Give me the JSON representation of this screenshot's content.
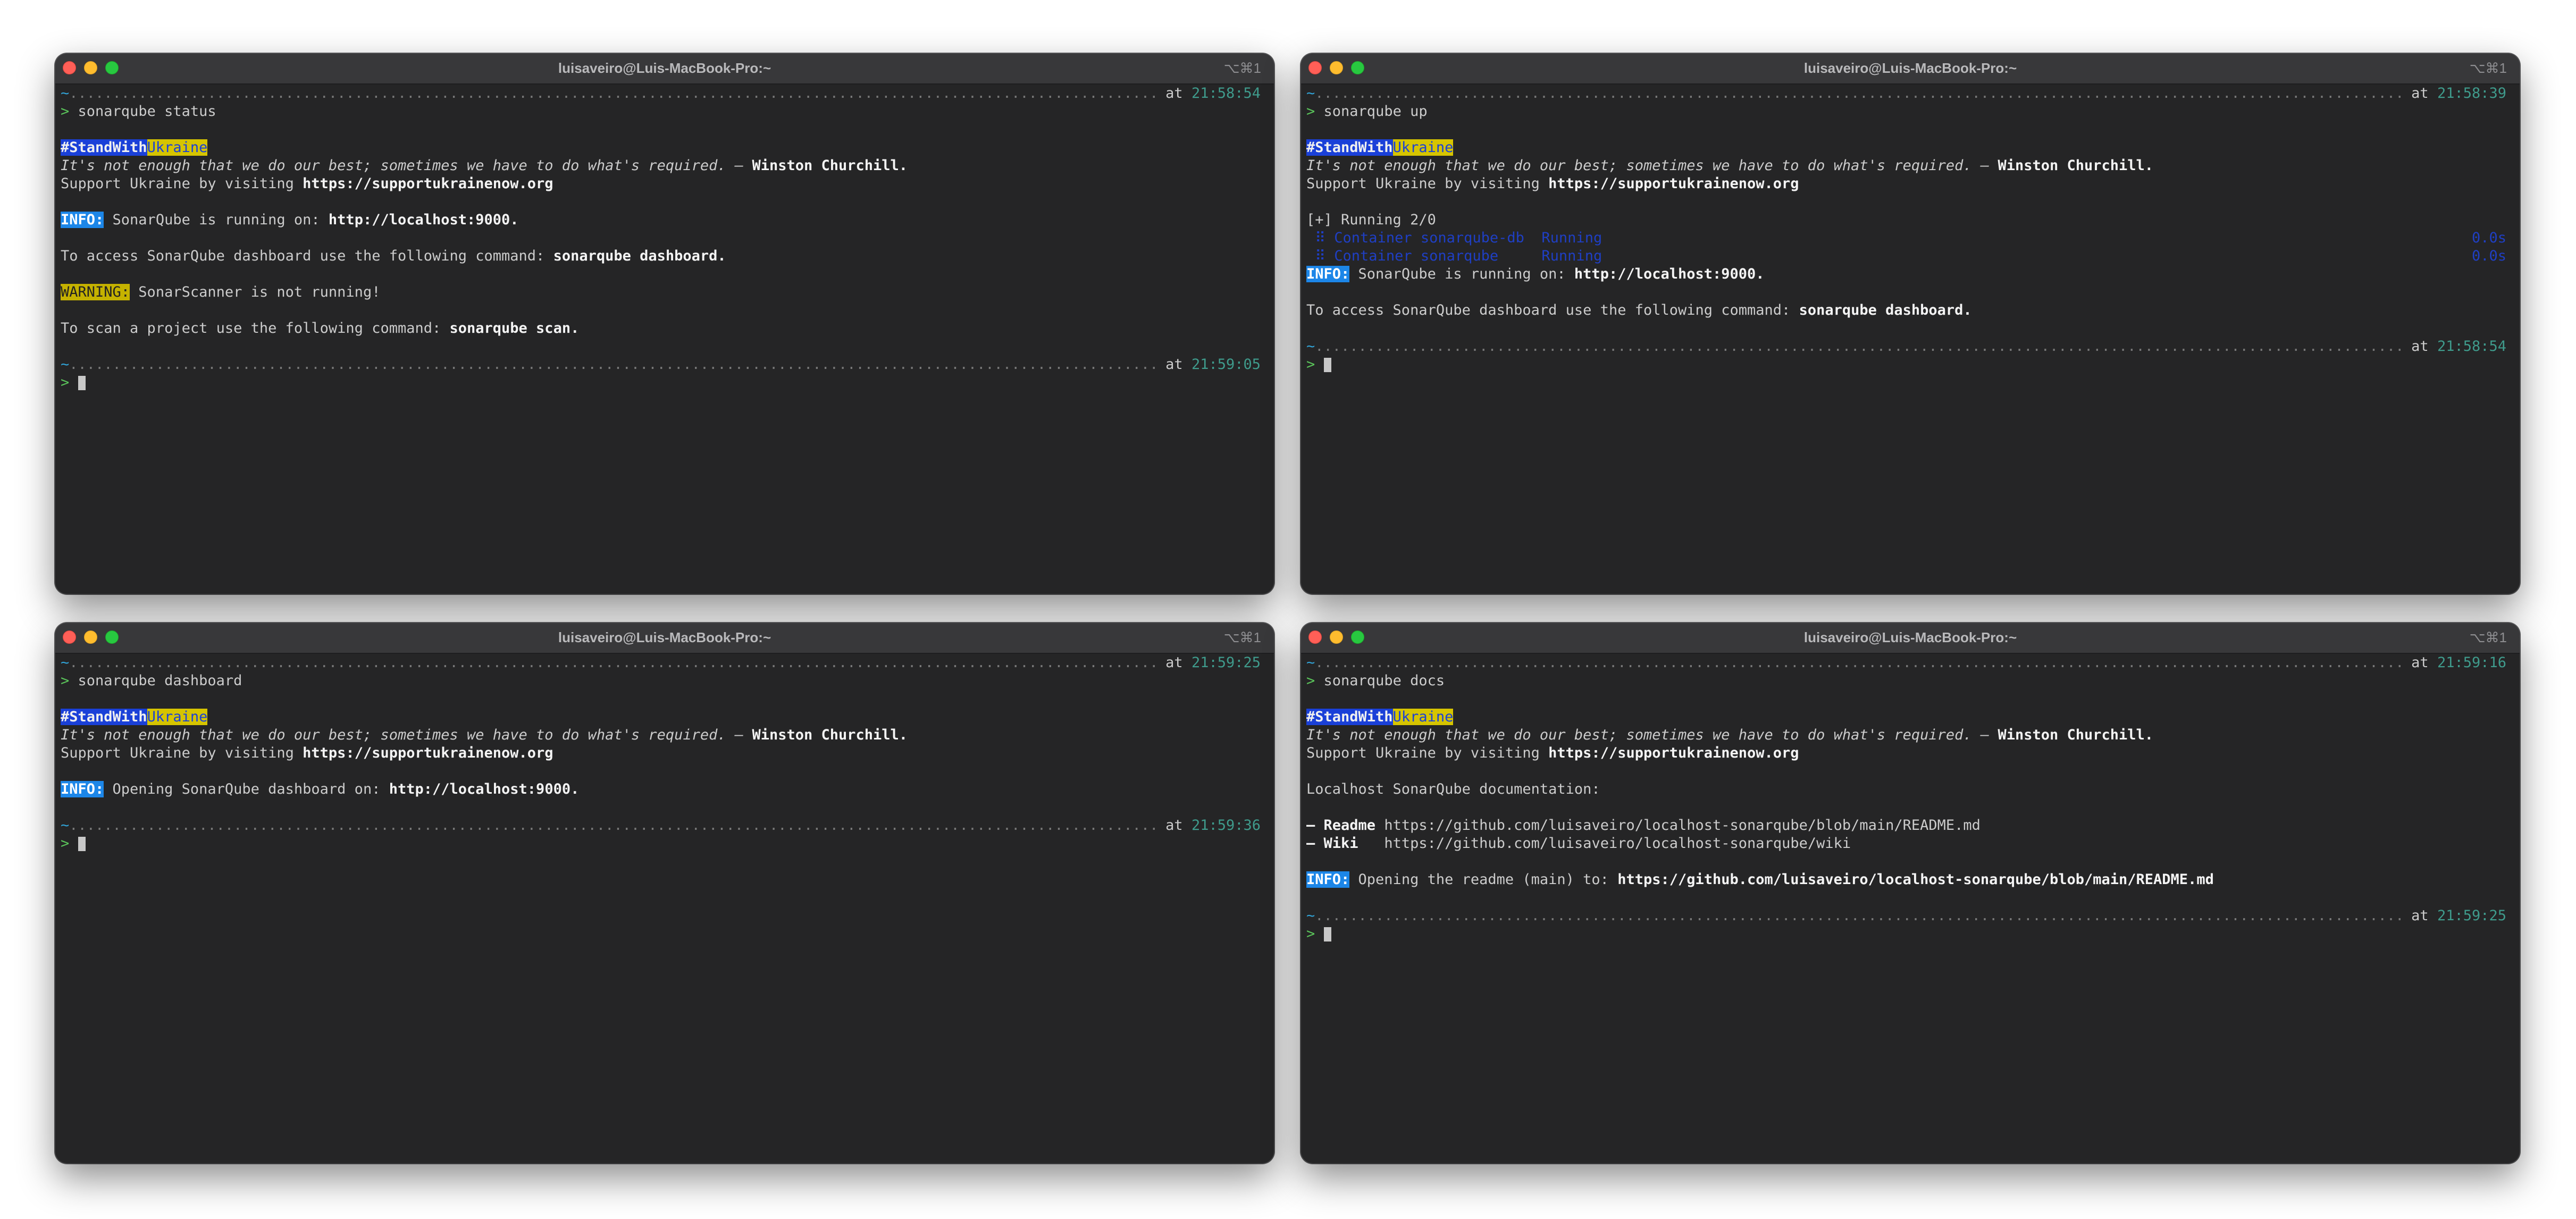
{
  "window": {
    "title": "luisaveiro@Luis-MacBook-Pro:~",
    "shortcut": "⌥⌘1"
  },
  "banner": {
    "hashtag": "#StandWith",
    "ukraine": "Ukraine",
    "quote": "It's not enough that we do our best; sometimes we have to do what's required. — ",
    "author": "Winston Churchill.",
    "support_prefix": "Support Ukraine by visiting ",
    "support_url": "https://supportukrainenow.org"
  },
  "prompt": {
    "tilde": "~",
    "at": " at ",
    "arrow": ">"
  },
  "panes": {
    "status": {
      "time_start": "21:58:54",
      "command": "sonarqube status",
      "info_label": "INFO:",
      "info_text": " SonarQube is running on: ",
      "info_url": "http://localhost:9000.",
      "access_text": "To access SonarQube dashboard use the following command: ",
      "access_cmd": "sonarqube dashboard.",
      "warning_label": "WARNING:",
      "warning_text": " SonarScanner is not running!",
      "scan_text": "To scan a project use the following command: ",
      "scan_cmd": "sonarqube scan.",
      "time_end": "21:59:05"
    },
    "up": {
      "time_start": "21:58:39",
      "command": "sonarqube up",
      "running": "[+] Running 2/0",
      "services": [
        {
          "line": " ⠿ Container sonarqube-db  Running",
          "time": "0.0s"
        },
        {
          "line": " ⠿ Container sonarqube     Running",
          "time": "0.0s"
        }
      ],
      "info_label": "INFO:",
      "info_text": " SonarQube is running on: ",
      "info_url": "http://localhost:9000.",
      "access_text": "To access SonarQube dashboard use the following command: ",
      "access_cmd": "sonarqube dashboard.",
      "time_end": "21:58:54"
    },
    "dashboard": {
      "time_start": "21:59:25",
      "command": "sonarqube dashboard",
      "info_label": "INFO:",
      "info_text": " Opening SonarQube dashboard on: ",
      "info_url": "http://localhost:9000.",
      "time_end": "21:59:36"
    },
    "docs": {
      "time_start": "21:59:16",
      "command": "sonarqube docs",
      "heading": "Localhost SonarQube documentation:",
      "links": [
        {
          "label": "— Readme",
          "pad": " ",
          "url": "https://github.com/luisaveiro/localhost-sonarqube/blob/main/README.md"
        },
        {
          "label": "— Wiki",
          "pad": "   ",
          "url": "https://github.com/luisaveiro/localhost-sonarqube/wiki"
        }
      ],
      "info_label": "INFO:",
      "info_text": " Opening the readme (main) to: ",
      "info_url": "https://github.com/luisaveiro/localhost-sonarqube/blob/main/README.md",
      "time_end": "21:59:25"
    }
  }
}
